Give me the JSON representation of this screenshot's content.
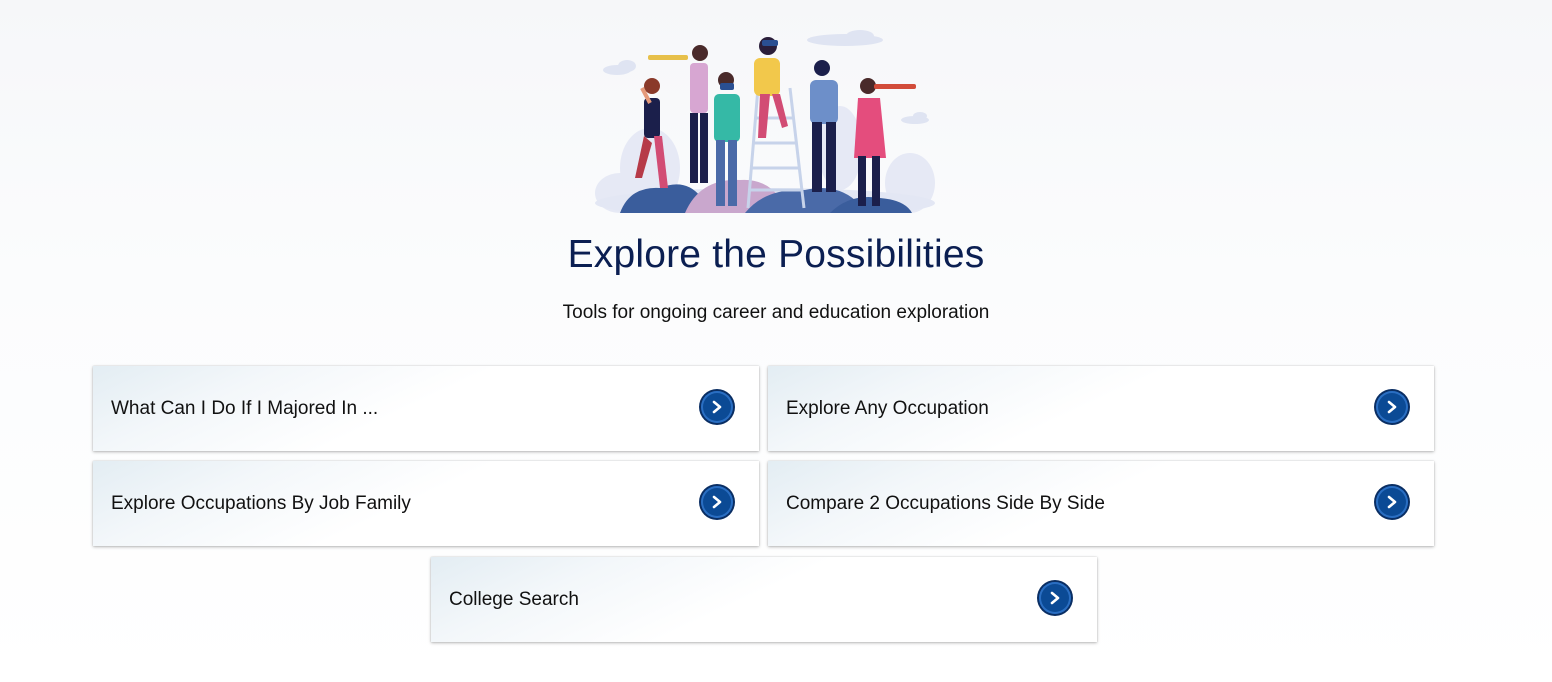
{
  "hero": {
    "image_name": "explorers-illustration"
  },
  "page": {
    "title": "Explore the Possibilities",
    "subtitle": "Tools for ongoing career and education exploration"
  },
  "cards": [
    {
      "label": "What Can I Do If I Majored In ...",
      "icon": "chevron-right-icon"
    },
    {
      "label": "Explore Any Occupation",
      "icon": "chevron-right-icon"
    },
    {
      "label": "Explore Occupations By Job Family",
      "icon": "chevron-right-icon"
    },
    {
      "label": "Compare 2 Occupations Side By Side",
      "icon": "chevron-right-icon"
    },
    {
      "label": "College Search",
      "icon": "chevron-right-icon"
    }
  ],
  "colors": {
    "title": "#0b1f52",
    "button": "#0b4a95",
    "button_border": "#0a2e63"
  }
}
